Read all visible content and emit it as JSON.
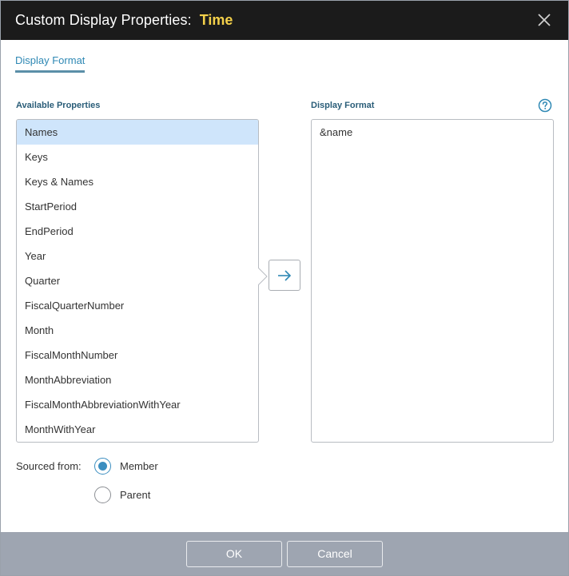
{
  "dialog": {
    "title_prefix": "Custom Display Properties:",
    "title_accent": "Time"
  },
  "tabs": [
    {
      "label": "Display Format",
      "active": true
    }
  ],
  "available": {
    "label": "Available Properties",
    "selected_index": 0,
    "items": [
      "Names",
      "Keys",
      "Keys & Names",
      "StartPeriod",
      "EndPeriod",
      "Year",
      "Quarter",
      "FiscalQuarterNumber",
      "Month",
      "FiscalMonthNumber",
      "MonthAbbreviation",
      "FiscalMonthAbbreviationWithYear",
      "MonthWithYear"
    ]
  },
  "display_format": {
    "label": "Display Format",
    "value": "&name"
  },
  "sourced_from": {
    "label": "Sourced from:",
    "options": [
      {
        "label": "Member",
        "checked": true
      },
      {
        "label": "Parent",
        "checked": false
      }
    ]
  },
  "footer": {
    "ok_label": "OK",
    "cancel_label": "Cancel"
  },
  "colors": {
    "title_accent": "#f3d04a",
    "accent_blue": "#3b8ec0",
    "selection": "#cfe5fb",
    "footer": "#9ea5b1"
  },
  "icons": {
    "close": "close-icon",
    "help": "help-icon",
    "arrow": "arrow-right-icon"
  }
}
